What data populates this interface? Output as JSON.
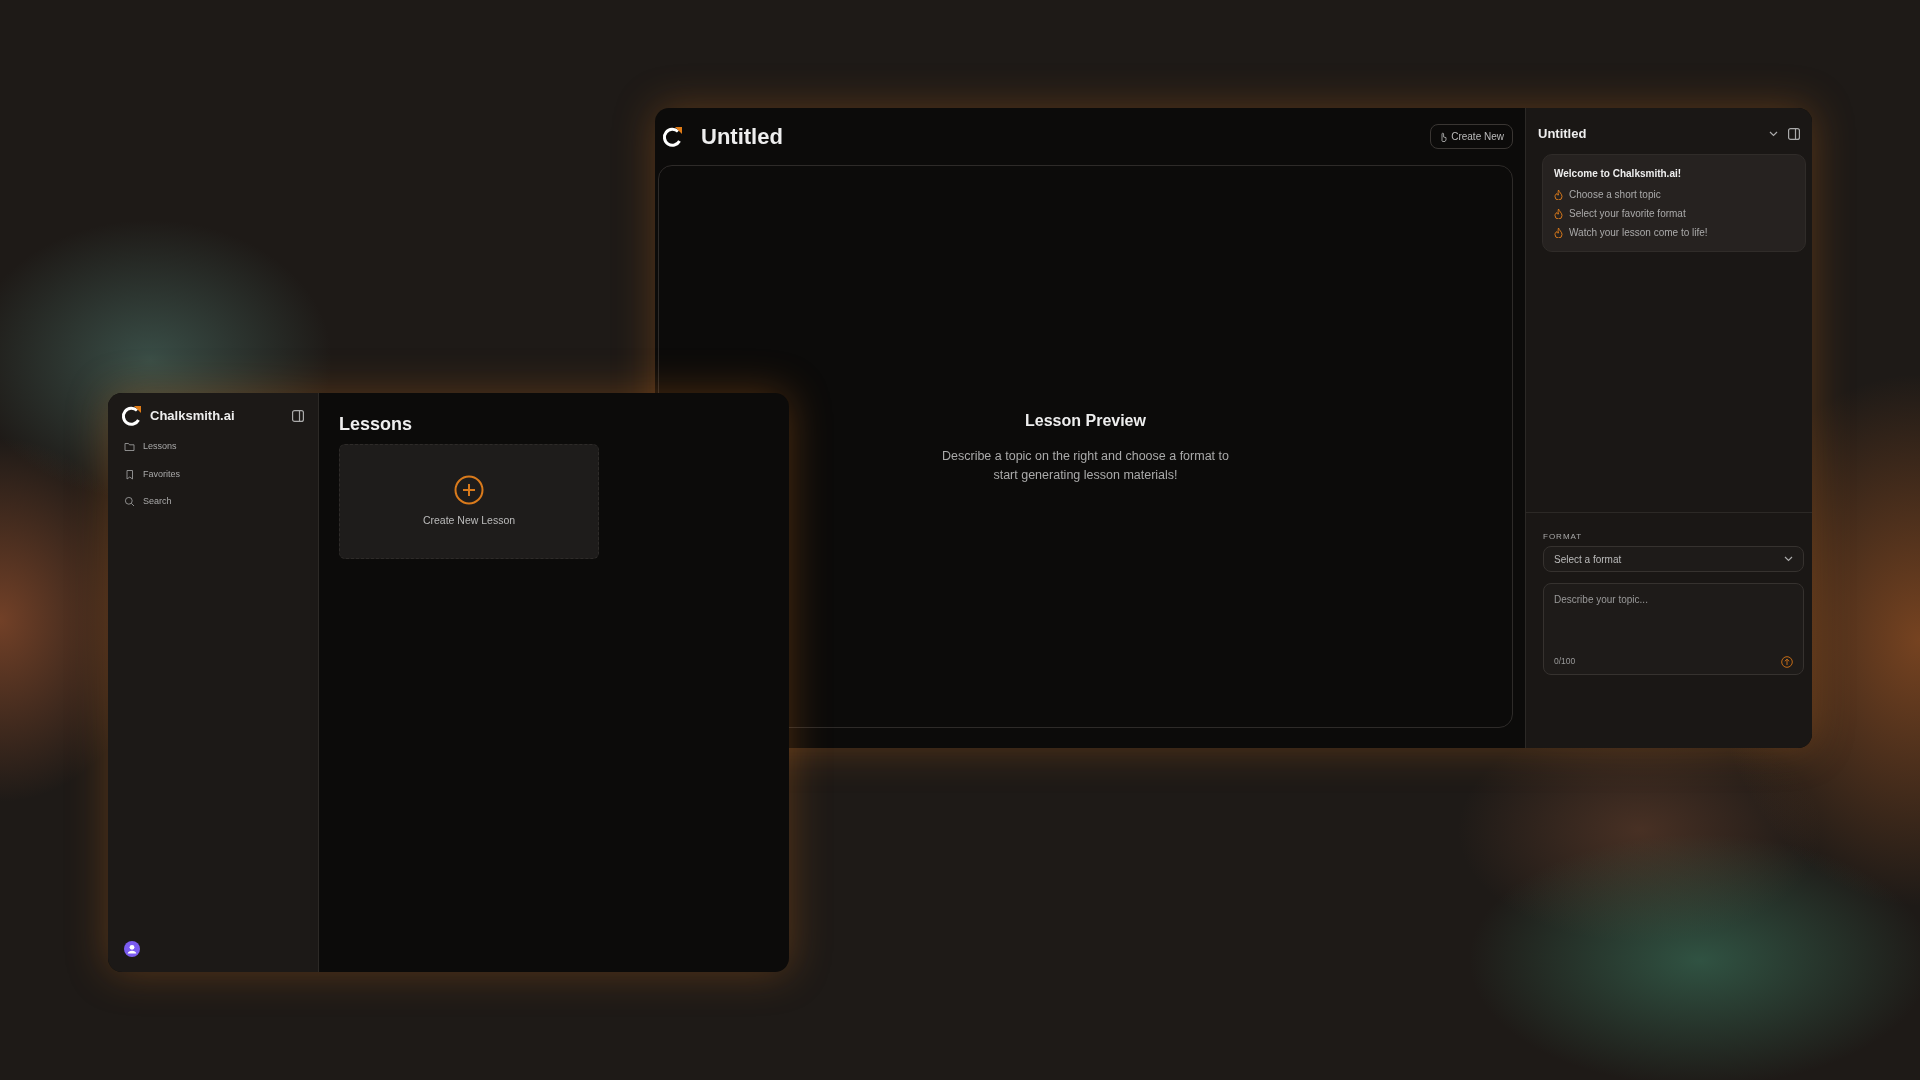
{
  "right_window": {
    "title": "Untitled",
    "create_button": "Create New",
    "preview": {
      "title": "Lesson Preview",
      "text": "Describe a topic on the right and choose a format to start generating lesson materials!"
    },
    "panel": {
      "title": "Untitled",
      "welcome": {
        "title": "Welcome to Chalksmith.ai!",
        "steps": [
          "Choose a short topic",
          "Select your favorite format",
          "Watch your lesson come to life!"
        ]
      },
      "format_label": "FORMAT",
      "format_select": {
        "placeholder": "Select a format"
      },
      "topic_field": {
        "placeholder": "Describe your topic...",
        "counter": "0/100"
      }
    }
  },
  "left_window": {
    "brand": "Chalksmith.ai",
    "nav": [
      {
        "label": "Lessons",
        "kind": "folder"
      },
      {
        "label": "Favorites",
        "kind": "bookmark"
      },
      {
        "label": "Search",
        "kind": "search"
      }
    ],
    "heading": "Lessons",
    "new_card": "Create New Lesson"
  }
}
